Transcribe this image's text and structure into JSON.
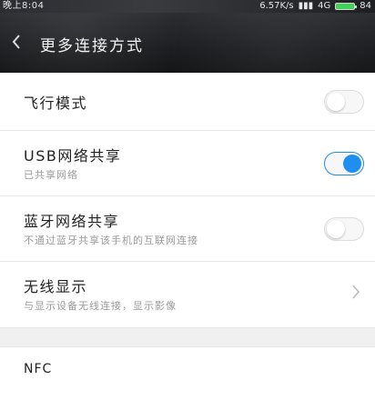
{
  "statusbar": {
    "time": "晚上8:04",
    "network_speed": "6.57K/s",
    "signal": "4G",
    "battery_label": "84"
  },
  "header": {
    "back_icon": "chevron-left-icon",
    "title": "更多连接方式"
  },
  "settings": [
    {
      "label": "飞行模式",
      "subtitle": "",
      "control": "toggle",
      "on": false
    },
    {
      "label": "USB网络共享",
      "subtitle": "已共享网络",
      "control": "toggle",
      "on": true
    },
    {
      "label": "蓝牙网络共享",
      "subtitle": "不通过蓝牙共享该手机的互联网连接",
      "control": "toggle",
      "on": false
    },
    {
      "label": "无线显示",
      "subtitle": "与显示设备无线连接，显示影像",
      "control": "chevron"
    }
  ],
  "nfc": {
    "label": "NFC"
  },
  "colors": {
    "accent": "#1e8ef0",
    "header_bg": "#1c1d20",
    "page_bg": "#f4f4f4"
  }
}
